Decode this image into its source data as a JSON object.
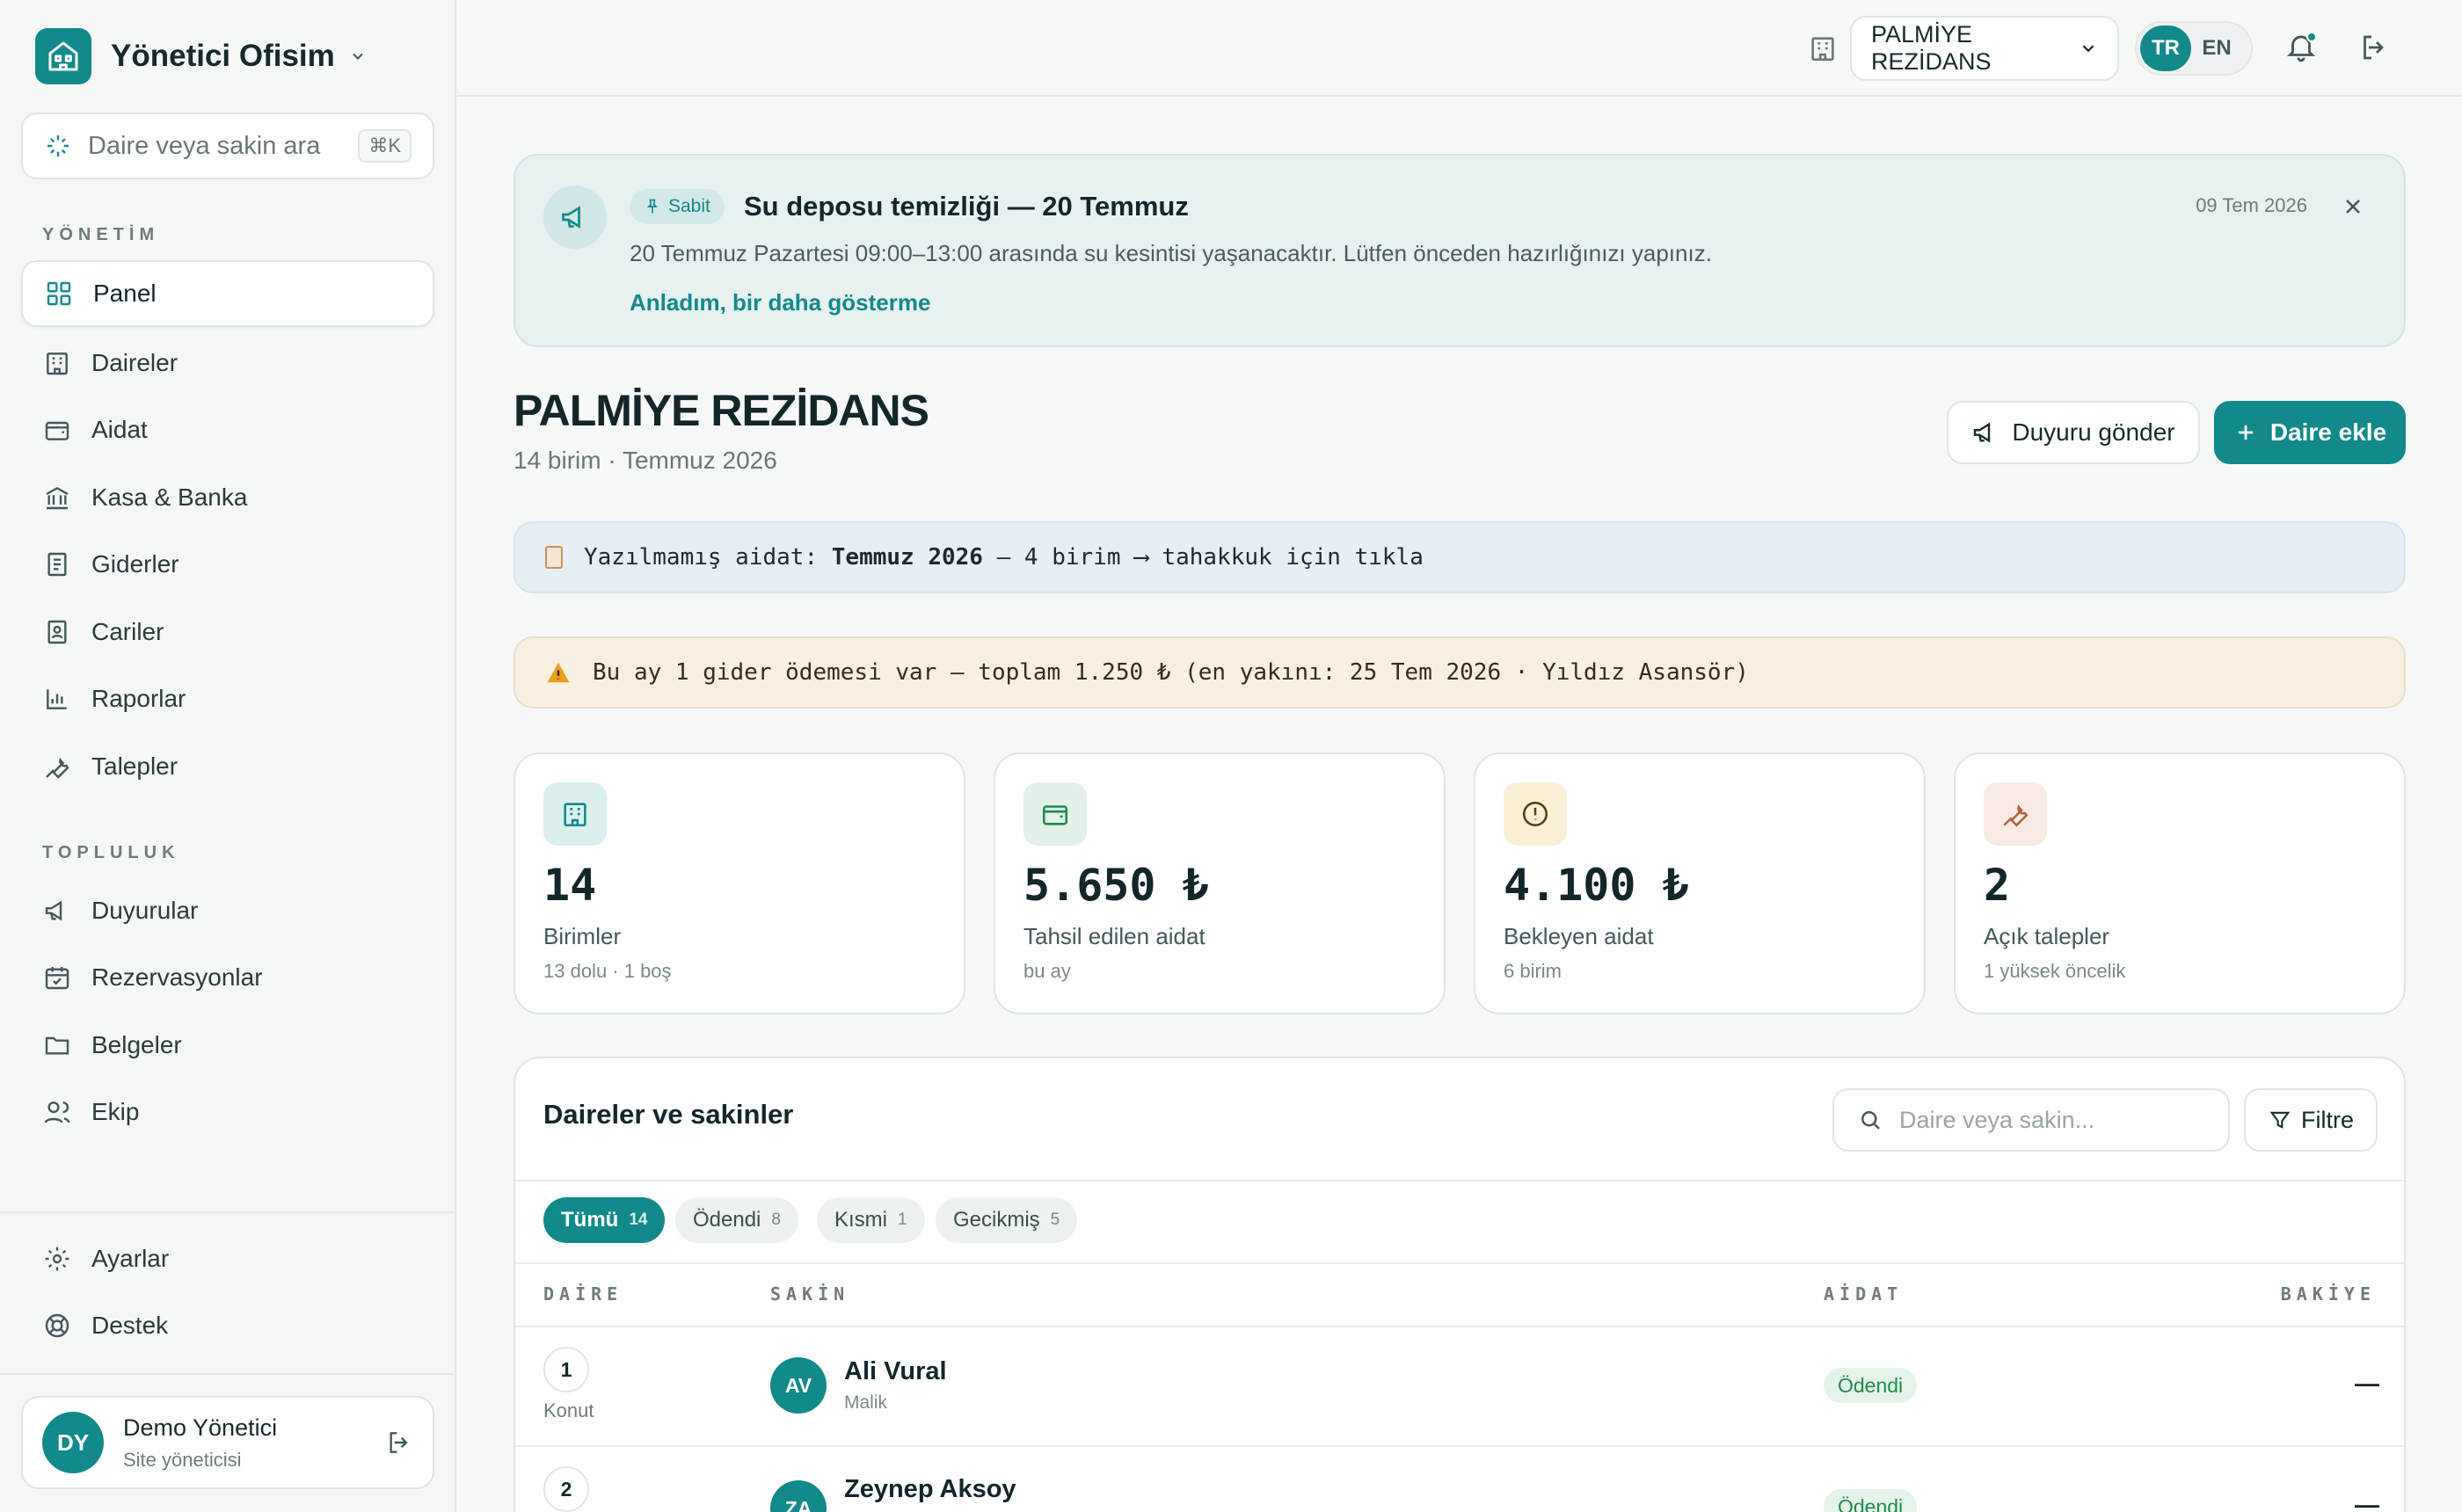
{
  "brand": {
    "name": "Yönetici Ofisim"
  },
  "search": {
    "placeholder": "Daire veya sakin ara",
    "shortcut": "⌘K"
  },
  "nav": {
    "section_management": "YÖNETİM",
    "management_items": [
      {
        "label": "Panel",
        "icon": "dashboard-icon",
        "active": true
      },
      {
        "label": "Daireler",
        "icon": "building-icon"
      },
      {
        "label": "Aidat",
        "icon": "wallet-icon"
      },
      {
        "label": "Kasa & Banka",
        "icon": "bank-icon"
      },
      {
        "label": "Giderler",
        "icon": "receipt-icon"
      },
      {
        "label": "Cariler",
        "icon": "contact-icon"
      },
      {
        "label": "Raporlar",
        "icon": "bar-chart-icon"
      },
      {
        "label": "Talepler",
        "icon": "wrench-icon"
      }
    ],
    "section_community": "TOPLULUK",
    "community_items": [
      {
        "label": "Duyurular",
        "icon": "megaphone-icon"
      },
      {
        "label": "Rezervasyonlar",
        "icon": "calendar-check-icon"
      },
      {
        "label": "Belgeler",
        "icon": "folder-icon"
      },
      {
        "label": "Ekip",
        "icon": "users-icon"
      }
    ],
    "bottom_items": [
      {
        "label": "Ayarlar",
        "icon": "gear-icon"
      },
      {
        "label": "Destek",
        "icon": "lifebuoy-icon"
      }
    ]
  },
  "user": {
    "initials": "DY",
    "name": "Demo Yönetici",
    "role": "Site yöneticisi"
  },
  "topbar": {
    "site": "PALMİYE REZİDANS",
    "lang_active": "TR",
    "lang_other": "EN"
  },
  "announcement": {
    "badge": "Sabit",
    "title": "Su deposu temizliği — 20 Temmuz",
    "date": "09 Tem 2026",
    "body": "20 Temmuz Pazartesi 09:00–13:00 arasında su kesintisi yaşanacaktır. Lütfen önceden hazırlığınızı yapınız.",
    "link": "Anladım, bir daha gösterme"
  },
  "page": {
    "title": "PALMİYE REZİDANS",
    "subtitle": "14 birim · Temmuz 2026"
  },
  "actions": {
    "announce": "Duyuru gönder",
    "add_unit": "Daire ekle"
  },
  "banners": {
    "unposted_prefix": "Yazılmamış aidat: ",
    "unposted_month": "Temmuz 2026",
    "unposted_suffix": " — 4 birim ⟶ tahakkuk için tıkla",
    "expense": "Bu ay 1 gider ödemesi var — toplam 1.250 ₺ (en yakını: 25 Tem 2026 · Yıldız Asansör)"
  },
  "stats": [
    {
      "value": "14",
      "label": "Birimler",
      "sub": "13 dolu · 1 boş",
      "icon": "building-icon",
      "color": "#12898a"
    },
    {
      "value": "5.650 ₺",
      "label": "Tahsil edilen aidat",
      "sub": "bu ay",
      "icon": "wallet-icon",
      "color": "#1f8a4c"
    },
    {
      "value": "4.100 ₺",
      "label": "Bekleyen aidat",
      "sub": "6 birim",
      "icon": "alert-circle-icon",
      "color": "#8a5a12"
    },
    {
      "value": "2",
      "label": "Açık talepler",
      "sub": "1 yüksek öncelik",
      "icon": "wrench-icon",
      "color": "#b0623e"
    }
  ],
  "table": {
    "title": "Daireler ve sakinler",
    "search_placeholder": "Daire veya sakin...",
    "filter": "Filtre",
    "chips": [
      {
        "label": "Tümü",
        "count": "14",
        "active": true
      },
      {
        "label": "Ödendi",
        "count": "8"
      },
      {
        "label": "Kısmi",
        "count": "1"
      },
      {
        "label": "Gecikmiş",
        "count": "5"
      }
    ],
    "headers": {
      "unit": "DAİRE",
      "resident": "SAKİN",
      "dues": "AİDAT",
      "balance": "BAKİYE"
    },
    "rows": [
      {
        "unit": "1",
        "unit_type": "Konut",
        "initials": "AV",
        "name": "Ali Vural",
        "role": "Malik",
        "status": "Ödendi",
        "balance": "—"
      },
      {
        "unit": "2",
        "unit_type": "",
        "initials": "ZA",
        "name": "Zeynep Aksoy",
        "role": "",
        "status": "Ödendi",
        "balance": "—"
      }
    ]
  }
}
